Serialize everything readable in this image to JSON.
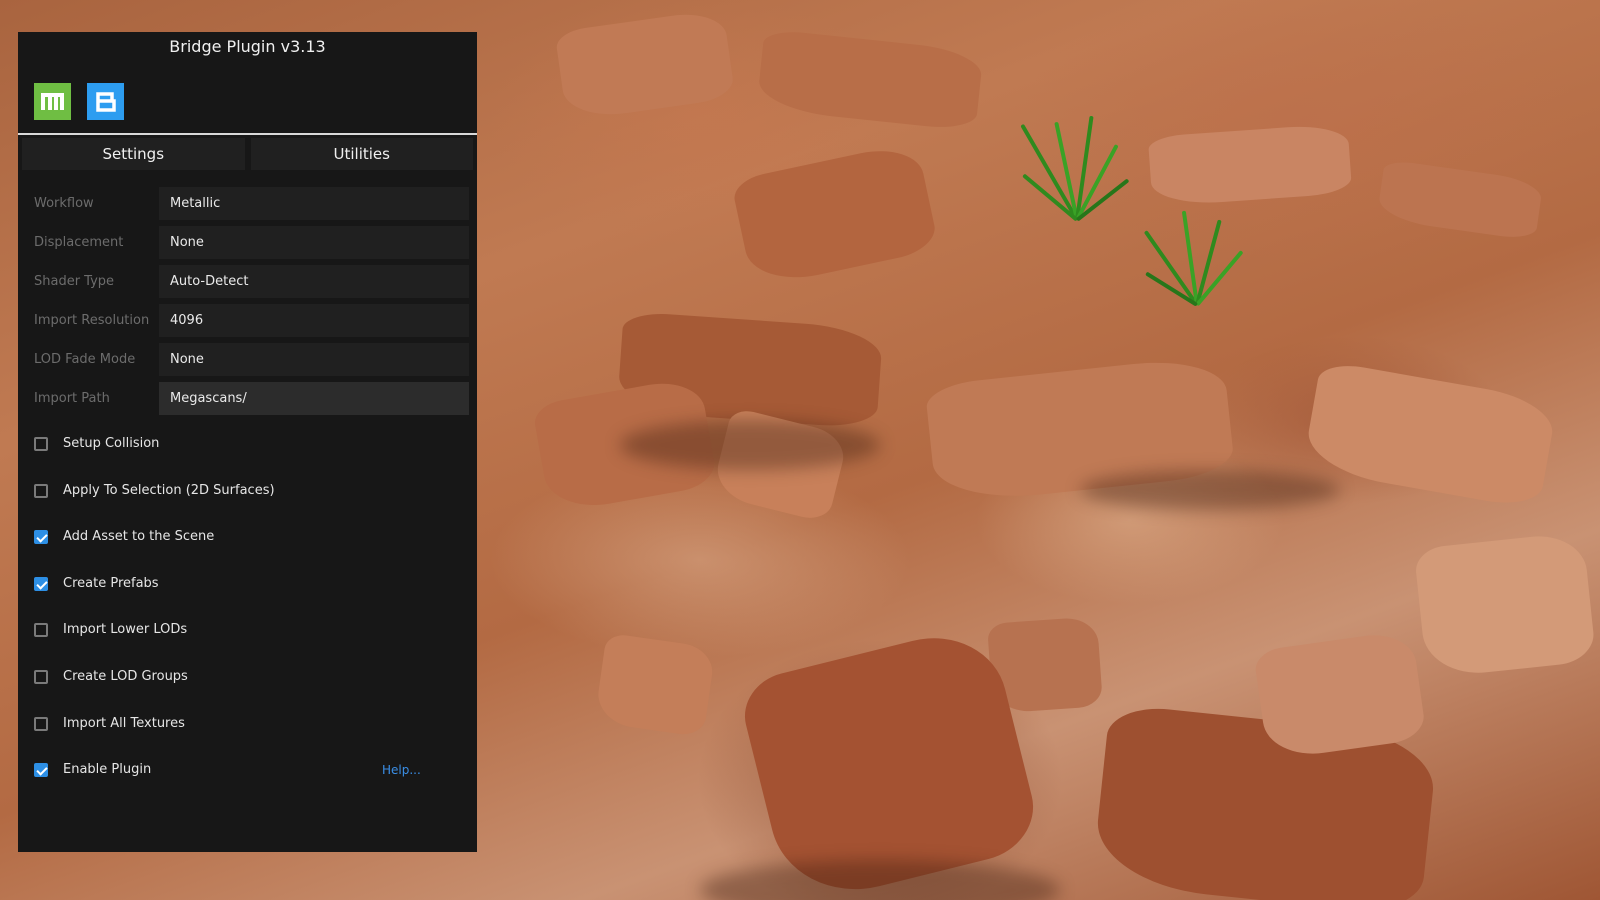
{
  "panel": {
    "title": "Bridge Plugin v3.13",
    "logos": [
      {
        "name": "megascans-logo",
        "letter": "m",
        "color": "#6fbe43"
      },
      {
        "name": "bridge-logo",
        "letter": "B",
        "color": "#2d9df0"
      }
    ],
    "tabs": [
      {
        "label": "Settings",
        "active": true
      },
      {
        "label": "Utilities",
        "active": false
      }
    ],
    "fields": [
      {
        "label": "Workflow",
        "value": "Metallic"
      },
      {
        "label": "Displacement",
        "value": "None"
      },
      {
        "label": "Shader Type",
        "value": "Auto-Detect"
      },
      {
        "label": "Import Resolution",
        "value": "4096"
      },
      {
        "label": "LOD Fade Mode",
        "value": "None"
      },
      {
        "label": "Import Path",
        "value": "Megascans/"
      }
    ],
    "checkboxes": [
      {
        "label": "Setup Collision",
        "checked": false
      },
      {
        "label": "Apply To Selection (2D Surfaces)",
        "checked": false
      },
      {
        "label": "Add Asset to the Scene",
        "checked": true
      },
      {
        "label": "Create Prefabs",
        "checked": true
      },
      {
        "label": "Import Lower LODs",
        "checked": false
      },
      {
        "label": "Create LOD Groups",
        "checked": false
      },
      {
        "label": "Import All Textures",
        "checked": false
      },
      {
        "label": "Enable Plugin",
        "checked": true
      }
    ],
    "help_link": "Help..."
  },
  "colors": {
    "panel_bg": "#171717",
    "accent": "#2d8fe5",
    "link": "#3a8ee6"
  }
}
